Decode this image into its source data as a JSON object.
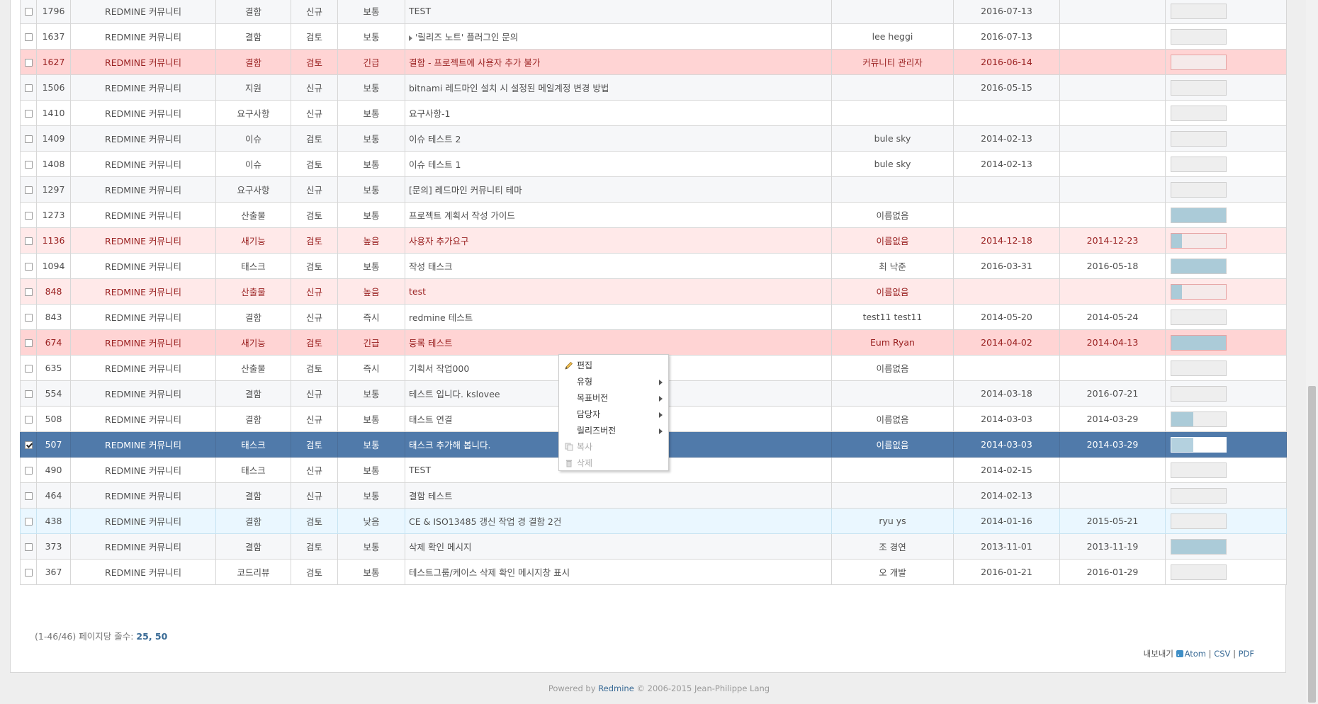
{
  "rows": [
    {
      "id": "1796",
      "project": "REDMINE 커뮤니티",
      "tracker": "결함",
      "status": "신규",
      "priority": "보통",
      "subject": "TEST",
      "assignee": "",
      "start": "2016-07-13",
      "due": "",
      "progress": 0,
      "style": "odd",
      "parent": false
    },
    {
      "id": "1637",
      "project": "REDMINE 커뮤니티",
      "tracker": "결함",
      "status": "검토",
      "priority": "보통",
      "subject": "'릴리즈 노트' 플러그인 문의",
      "assignee": "lee heggi",
      "start": "2016-07-13",
      "due": "",
      "progress": 0,
      "style": "even",
      "parent": true
    },
    {
      "id": "1627",
      "project": "REDMINE 커뮤니티",
      "tracker": "결함",
      "status": "검토",
      "priority": "긴급",
      "subject": "결함 - 프로젝트에 사용자 추가 불가",
      "assignee": "커뮤니티 관리자",
      "start": "2016-06-14",
      "due": "",
      "progress": 0,
      "style": "urgent",
      "parent": false
    },
    {
      "id": "1506",
      "project": "REDMINE 커뮤니티",
      "tracker": "지원",
      "status": "신규",
      "priority": "보통",
      "subject": "bitnami 레드마인 설치 시 설정된 메일계정 변경 방법",
      "assignee": "",
      "start": "2016-05-15",
      "due": "",
      "progress": 0,
      "style": "odd",
      "parent": false
    },
    {
      "id": "1410",
      "project": "REDMINE 커뮤니티",
      "tracker": "요구사항",
      "status": "신규",
      "priority": "보통",
      "subject": "요구사항-1",
      "assignee": "",
      "start": "",
      "due": "",
      "progress": 0,
      "style": "even",
      "parent": false
    },
    {
      "id": "1409",
      "project": "REDMINE 커뮤니티",
      "tracker": "이슈",
      "status": "검토",
      "priority": "보통",
      "subject": "이슈 테스트 2",
      "assignee": "bule sky",
      "start": "2014-02-13",
      "due": "",
      "progress": 0,
      "style": "odd",
      "parent": false
    },
    {
      "id": "1408",
      "project": "REDMINE 커뮤니티",
      "tracker": "이슈",
      "status": "검토",
      "priority": "보통",
      "subject": "이슈 테스트 1",
      "assignee": "bule sky",
      "start": "2014-02-13",
      "due": "",
      "progress": 0,
      "style": "even",
      "parent": false
    },
    {
      "id": "1297",
      "project": "REDMINE 커뮤니티",
      "tracker": "요구사항",
      "status": "신규",
      "priority": "보통",
      "subject": "[문의] 레드마인 커뮤니티 테마",
      "assignee": "",
      "start": "",
      "due": "",
      "progress": 0,
      "style": "odd",
      "parent": false
    },
    {
      "id": "1273",
      "project": "REDMINE 커뮤니티",
      "tracker": "산출물",
      "status": "검토",
      "priority": "보통",
      "subject": "프로젝트 계획서 작성 가이드",
      "assignee": "이름없음",
      "start": "",
      "due": "",
      "progress": 100,
      "style": "even",
      "parent": false
    },
    {
      "id": "1136",
      "project": "REDMINE 커뮤니티",
      "tracker": "새기능",
      "status": "검토",
      "priority": "높음",
      "subject": "사용자 추가요구",
      "assignee": "이름없음",
      "start": "2014-12-18",
      "due": "2014-12-23",
      "progress": 20,
      "style": "high",
      "parent": false
    },
    {
      "id": "1094",
      "project": "REDMINE 커뮤니티",
      "tracker": "태스크",
      "status": "검토",
      "priority": "보통",
      "subject": "작성 태스크",
      "assignee": "최 낙준",
      "start": "2016-03-31",
      "due": "2016-05-18",
      "progress": 100,
      "style": "even",
      "parent": false
    },
    {
      "id": "848",
      "project": "REDMINE 커뮤니티",
      "tracker": "산출물",
      "status": "신규",
      "priority": "높음",
      "subject": "test",
      "assignee": "이름없음",
      "start": "",
      "due": "",
      "progress": 20,
      "style": "high",
      "parent": false
    },
    {
      "id": "843",
      "project": "REDMINE 커뮤니티",
      "tracker": "결함",
      "status": "신규",
      "priority": "즉시",
      "subject": "redmine 테스트",
      "assignee": "test11 test11",
      "start": "2014-05-20",
      "due": "2014-05-24",
      "progress": 0,
      "style": "even",
      "parent": false
    },
    {
      "id": "674",
      "project": "REDMINE 커뮤니티",
      "tracker": "새기능",
      "status": "검토",
      "priority": "긴급",
      "subject": "등록 테스트",
      "assignee": "Eum Ryan",
      "start": "2014-04-02",
      "due": "2014-04-13",
      "progress": 100,
      "style": "urgent",
      "parent": false
    },
    {
      "id": "635",
      "project": "REDMINE 커뮤니티",
      "tracker": "산출물",
      "status": "검토",
      "priority": "즉시",
      "subject": "기획서 작업000",
      "assignee": "이름없음",
      "start": "",
      "due": "",
      "progress": 0,
      "style": "even",
      "parent": false
    },
    {
      "id": "554",
      "project": "REDMINE 커뮤니티",
      "tracker": "결함",
      "status": "신규",
      "priority": "보통",
      "subject": "테스트 입니다. kslovee",
      "assignee": "",
      "start": "2014-03-18",
      "due": "2016-07-21",
      "progress": 0,
      "style": "odd",
      "parent": false
    },
    {
      "id": "508",
      "project": "REDMINE 커뮤니티",
      "tracker": "결함",
      "status": "신규",
      "priority": "보통",
      "subject": "태스트 연결",
      "assignee": "이름없음",
      "start": "2014-03-03",
      "due": "2014-03-29",
      "progress": 40,
      "style": "even",
      "parent": false
    },
    {
      "id": "507",
      "project": "REDMINE 커뮤니티",
      "tracker": "태스크",
      "status": "검토",
      "priority": "보통",
      "subject": "태스크 추가해 봅니다.",
      "assignee": "이름없음",
      "start": "2014-03-03",
      "due": "2014-03-29",
      "progress": 40,
      "style": "selected",
      "parent": false
    },
    {
      "id": "490",
      "project": "REDMINE 커뮤니티",
      "tracker": "태스크",
      "status": "신규",
      "priority": "보통",
      "subject": "TEST",
      "assignee": "",
      "start": "2014-02-15",
      "due": "",
      "progress": 0,
      "style": "even",
      "parent": false
    },
    {
      "id": "464",
      "project": "REDMINE 커뮤니티",
      "tracker": "결함",
      "status": "신규",
      "priority": "보통",
      "subject": "결함 테스트",
      "assignee": "",
      "start": "2014-02-13",
      "due": "",
      "progress": 0,
      "style": "odd",
      "parent": false
    },
    {
      "id": "438",
      "project": "REDMINE 커뮤니티",
      "tracker": "결함",
      "status": "검토",
      "priority": "낮음",
      "subject": "CE & ISO13485 갱신 작업 경 결함 2건",
      "assignee": "ryu ys",
      "start": "2014-01-16",
      "due": "2015-05-21",
      "progress": 0,
      "style": "low",
      "parent": false
    },
    {
      "id": "373",
      "project": "REDMINE 커뮤니티",
      "tracker": "결함",
      "status": "검토",
      "priority": "보통",
      "subject": "삭제 확인 메시지",
      "assignee": "조 경연",
      "start": "2013-11-01",
      "due": "2013-11-19",
      "progress": 100,
      "style": "odd",
      "parent": false
    },
    {
      "id": "367",
      "project": "REDMINE 커뮤니티",
      "tracker": "코드리뷰",
      "status": "검토",
      "priority": "보통",
      "subject": "테스트그룹/케이스 삭제 확인 메시지창 표시",
      "assignee": "오 개발",
      "start": "2016-01-21",
      "due": "2016-01-29",
      "progress": 0,
      "style": "even",
      "parent": false
    }
  ],
  "pagination": {
    "range": "(1-46/46)",
    "per_page_label": "페이지당 줄수:",
    "per_page_options": [
      "25",
      "50"
    ]
  },
  "export": {
    "label": "내보내기",
    "formats": [
      "Atom",
      "CSV",
      "PDF"
    ]
  },
  "footer": {
    "prefix": "Powered by",
    "link": "Redmine",
    "suffix": "© 2006-2015 Jean-Philippe Lang"
  },
  "context_menu": {
    "items": [
      {
        "label": "편집",
        "icon": "pencil-icon",
        "submenu": false,
        "disabled": false
      },
      {
        "label": "유형",
        "icon": "",
        "submenu": true,
        "disabled": false
      },
      {
        "label": "목표버전",
        "icon": "",
        "submenu": true,
        "disabled": false
      },
      {
        "label": "담당자",
        "icon": "",
        "submenu": true,
        "disabled": false
      },
      {
        "label": "릴리즈버전",
        "icon": "",
        "submenu": true,
        "disabled": false
      },
      {
        "label": "복사",
        "icon": "copy-icon",
        "submenu": false,
        "disabled": true
      },
      {
        "label": "삭제",
        "icon": "trash-icon",
        "submenu": false,
        "disabled": true
      }
    ]
  },
  "colors": {
    "selected_row": "#507aaa",
    "urgent_row": "#ffd4d4",
    "high_row": "#ffe9e9",
    "link": "#3a6b96",
    "progress_fill": "#abcbd8"
  }
}
